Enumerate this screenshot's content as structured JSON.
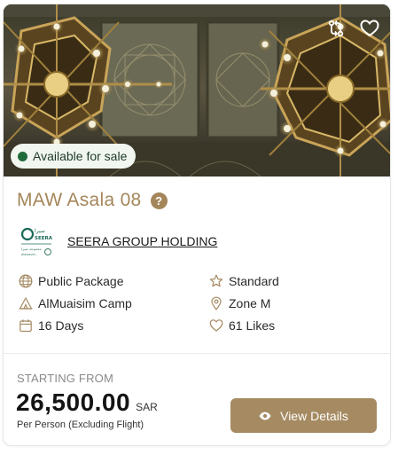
{
  "card": {
    "status_badge": "Available for sale",
    "title": "MAW Asala 08",
    "provider": {
      "name": "SEERA GROUP HOLDING",
      "logo_text": "SEERA"
    },
    "features": [
      {
        "icon": "globe-icon",
        "label": "Public Package"
      },
      {
        "icon": "star-icon",
        "label": "Standard"
      },
      {
        "icon": "tent-icon",
        "label": "AlMuaisim Camp"
      },
      {
        "icon": "location-pin-icon",
        "label": "Zone M"
      },
      {
        "icon": "calendar-icon",
        "label": "16 Days"
      },
      {
        "icon": "heart-icon",
        "label": "61 Likes"
      }
    ],
    "price": {
      "label": "STARTING FROM",
      "value": "26,500.00",
      "currency": "SAR",
      "note": "Per Person (Excluding Flight)"
    },
    "cta_label": "View Details"
  },
  "colors": {
    "accent": "#a58a62",
    "status_green": "#1f6b3a",
    "badge_bg": "#f1f7f0",
    "title_gold": "#a4865a"
  },
  "icons": {
    "compare": "compare-arrows-icon",
    "favorite": "heart-outline-icon",
    "help": "question-circle-icon",
    "view": "eye-icon"
  }
}
